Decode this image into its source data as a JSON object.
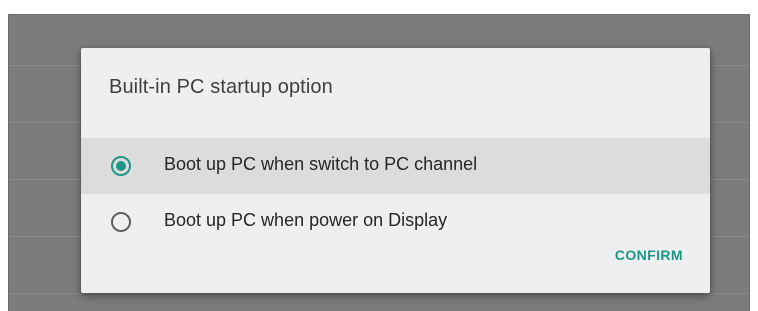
{
  "dialog": {
    "title": "Built-in PC startup option",
    "options": [
      {
        "label": "Boot up PC when switch to PC channel",
        "selected": true
      },
      {
        "label": "Boot up PC when power on Display",
        "selected": false
      }
    ],
    "confirm_label": "CONFIRM"
  },
  "colors": {
    "accent": "#1e9687",
    "dialog_background": "#eeeff0",
    "selected_row": "#dcdcdc",
    "backdrop": "#7c7c7c"
  }
}
